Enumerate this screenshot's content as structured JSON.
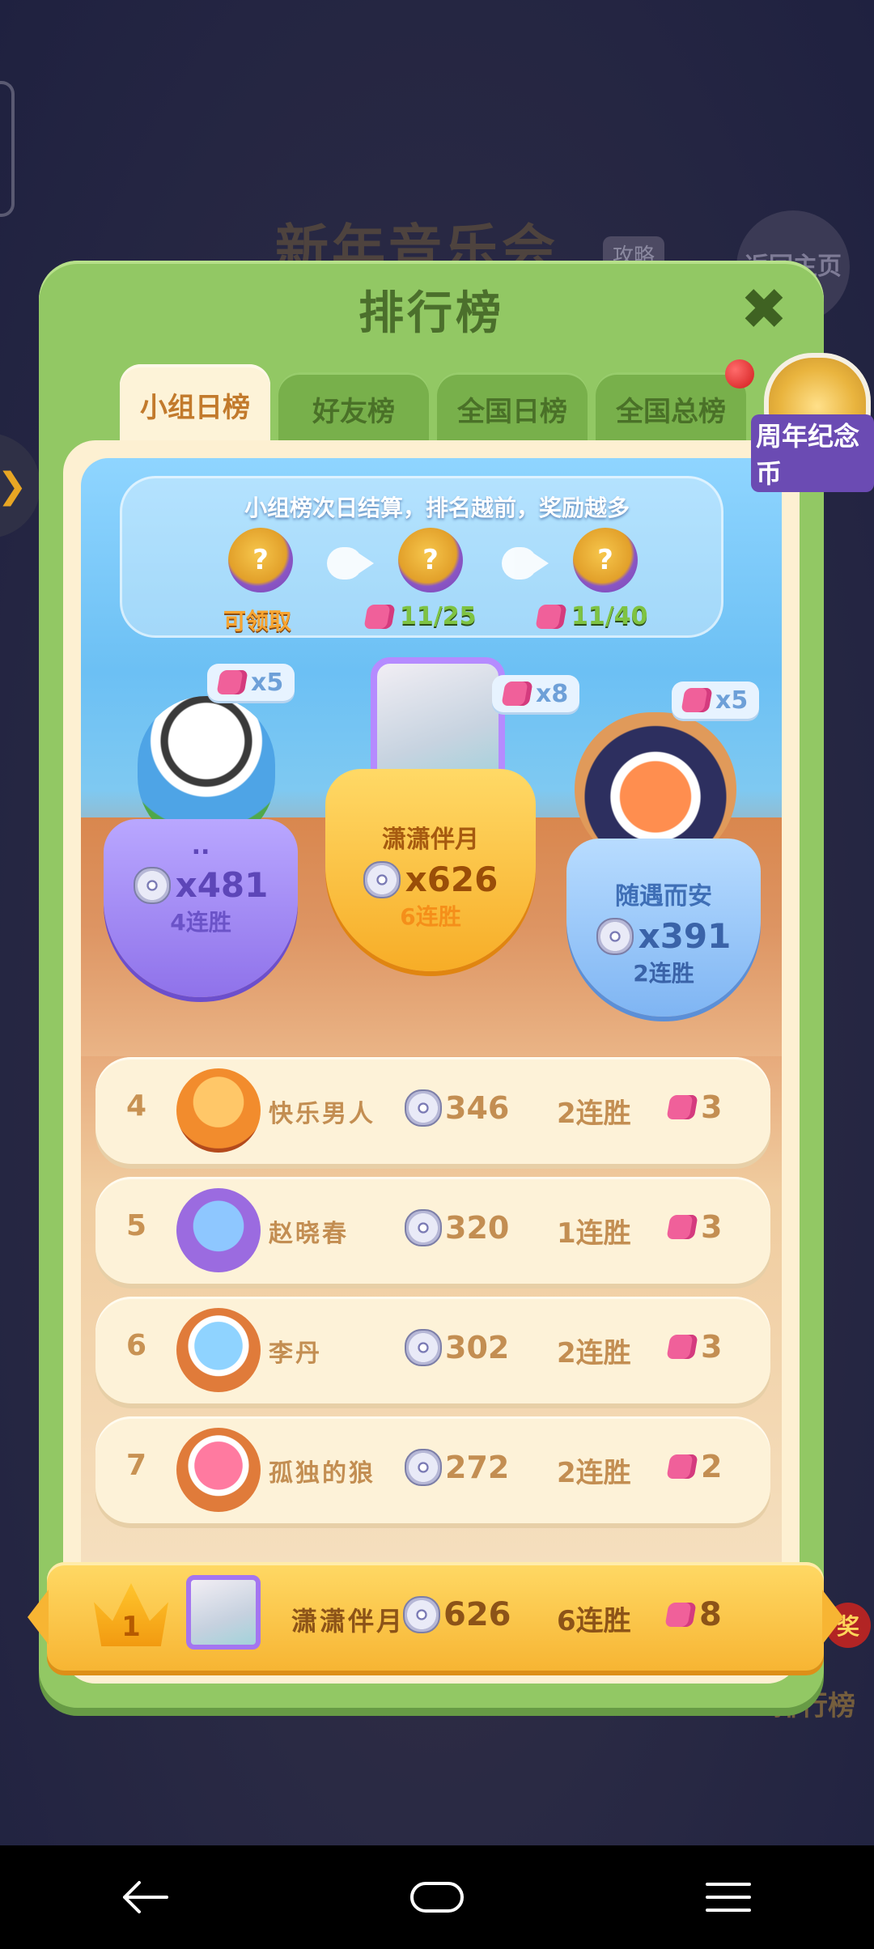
{
  "background": {
    "title": "新年音乐会",
    "guide_label": "攻略",
    "return_label": "返回主页",
    "side_rank_label": "排行榜",
    "prize_badge": "奖"
  },
  "panel": {
    "title": "排行榜",
    "close_icon": "close-icon",
    "tabs": [
      {
        "label": "小组日榜",
        "active": true
      },
      {
        "label": "好友榜",
        "active": false
      },
      {
        "label": "全国日榜",
        "active": false
      },
      {
        "label": "全国总榜",
        "active": false
      }
    ],
    "anniversary_coin_label": "周年纪念币"
  },
  "rewards": {
    "banner_text": "小组榜次日结算，排名越前，奖励越多",
    "claimable_label": "可领取",
    "chest_symbol": "?",
    "progress": [
      "11/25",
      "11/40"
    ]
  },
  "podium": [
    {
      "place": 2,
      "name": "..",
      "score": "x481",
      "streak": "4连胜",
      "tickets": "x5"
    },
    {
      "place": 1,
      "name": "潇潇伴月",
      "score": "x626",
      "streak": "6连胜",
      "tickets": "x8"
    },
    {
      "place": 3,
      "name": "随遇而安",
      "score": "x391",
      "streak": "2连胜",
      "tickets": "x5"
    }
  ],
  "rows": [
    {
      "rank": "4",
      "name": "快乐男人",
      "score": "346",
      "streak": "2连胜",
      "tickets": "3"
    },
    {
      "rank": "5",
      "name": "赵晓春",
      "score": "320",
      "streak": "1连胜",
      "tickets": "3"
    },
    {
      "rank": "6",
      "name": "李丹",
      "score": "302",
      "streak": "2连胜",
      "tickets": "3"
    },
    {
      "rank": "7",
      "name": "孤独的狼",
      "score": "272",
      "streak": "2连胜",
      "tickets": "2"
    }
  ],
  "my_rank": {
    "rank": "1",
    "name": "潇潇伴月",
    "score": "626",
    "streak": "6连胜",
    "tickets": "8"
  },
  "colors": {
    "panel_green": "#92c864",
    "gold": "#f7b533",
    "ticket_pink": "#f0609a"
  }
}
